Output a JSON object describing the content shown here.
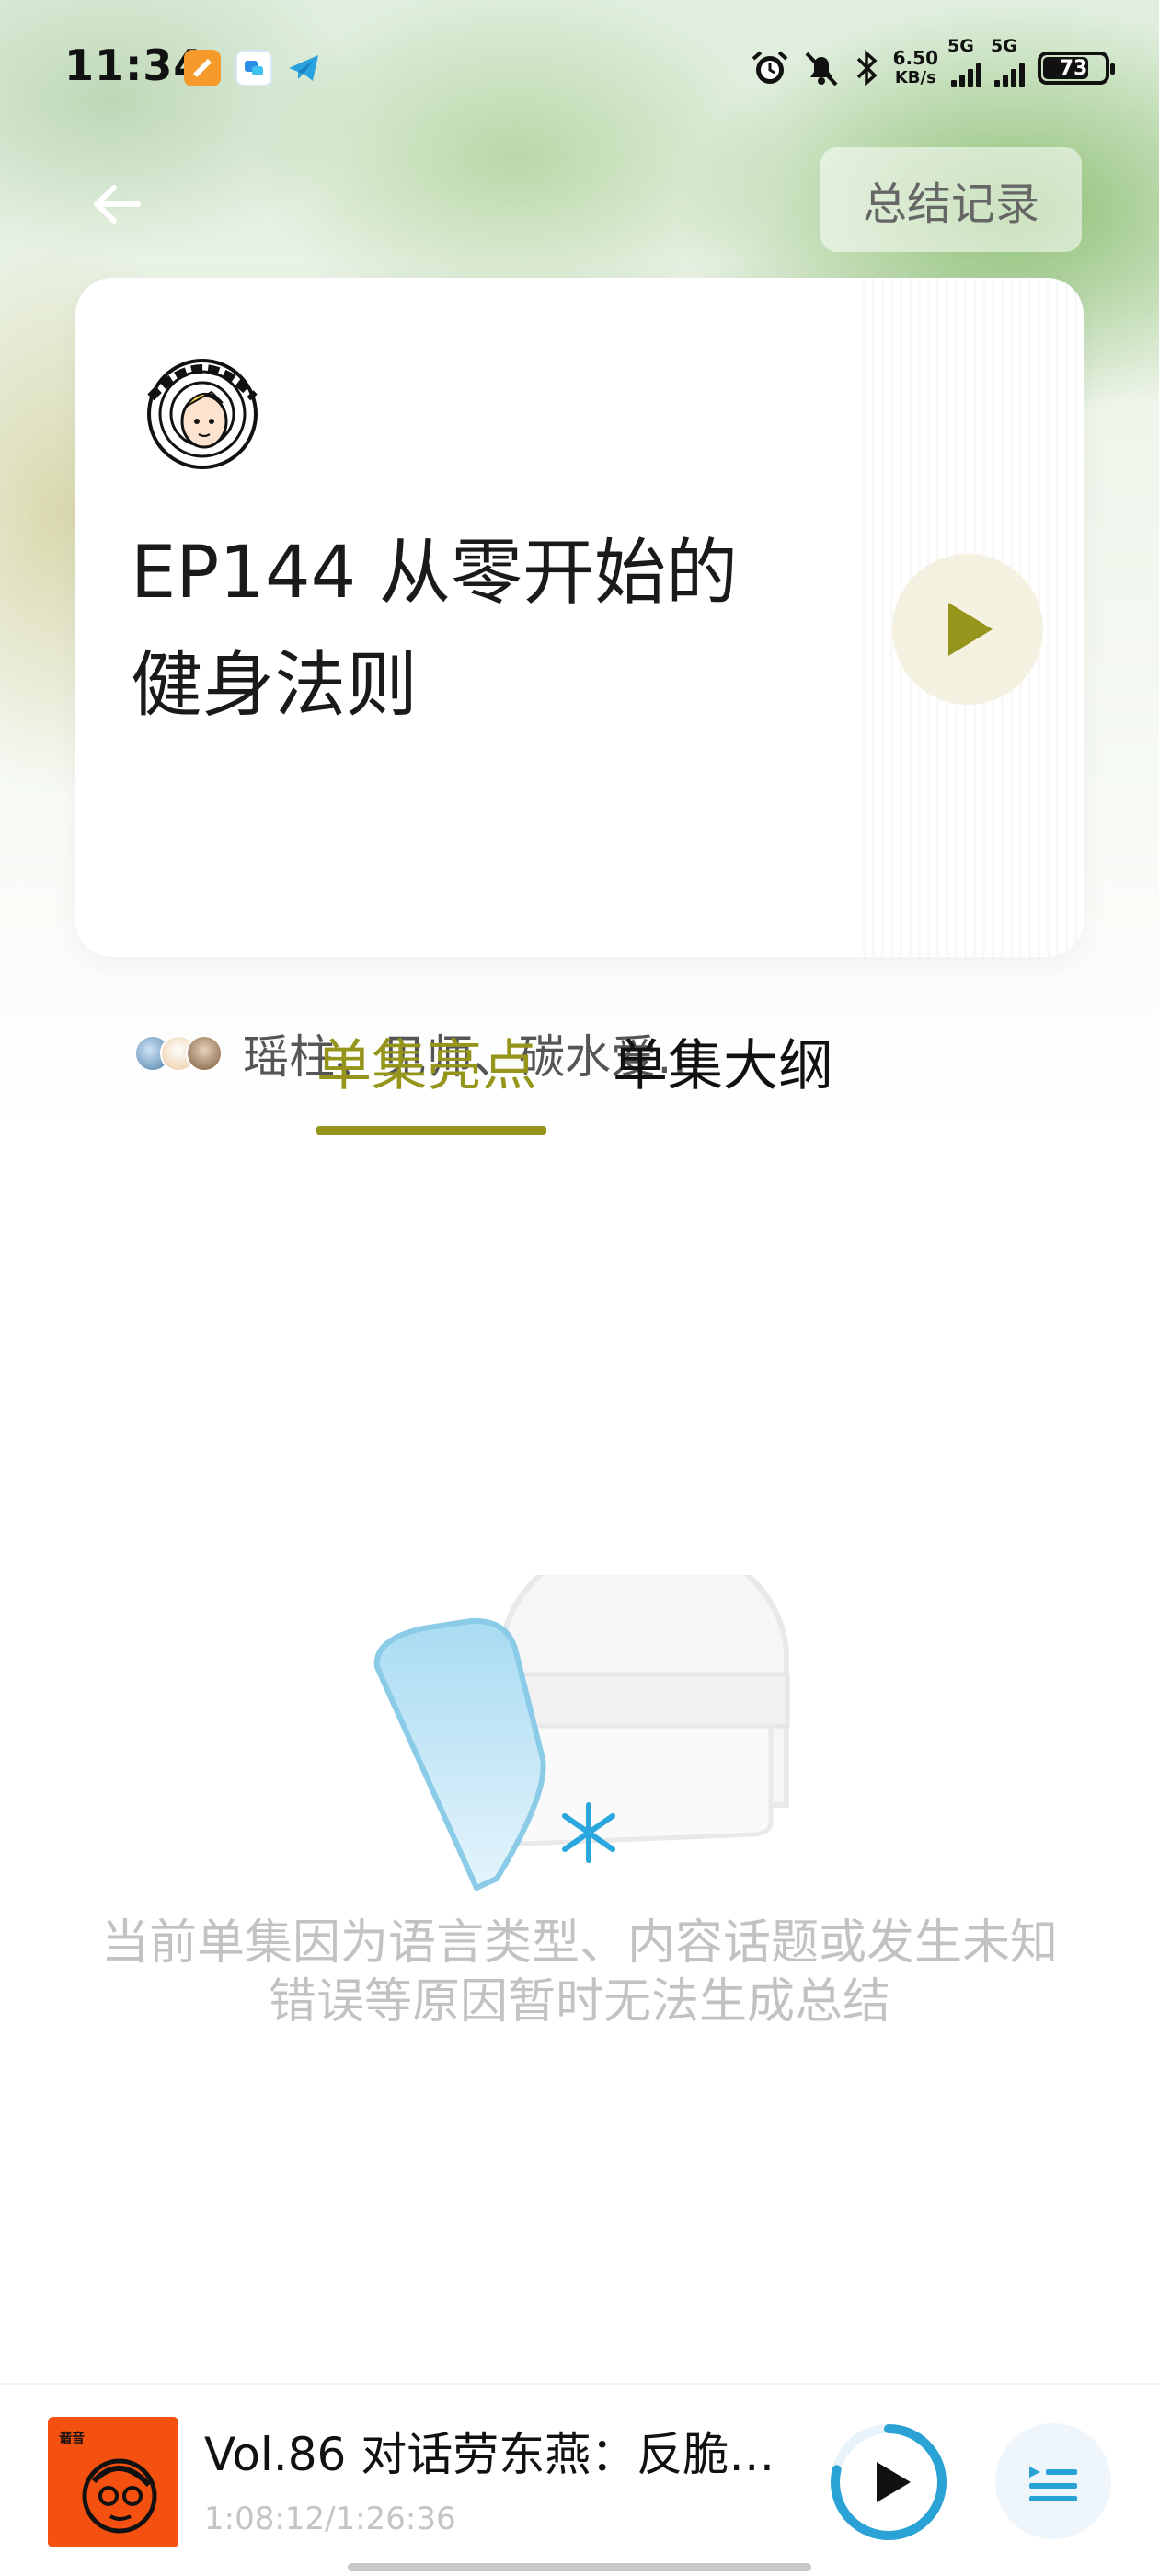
{
  "status_bar": {
    "time": "11:34",
    "net_speed": "6.50",
    "net_unit": "KB/s",
    "sim1": "5G",
    "sim2": "5G",
    "battery": "73"
  },
  "header": {
    "summary_button": "总结记录"
  },
  "episode": {
    "title_line1": "EP144 从零开始的",
    "title_line2": "健身法则",
    "hosts": "瑶柱、见师、碳水爱…",
    "accent_color": "#96951b"
  },
  "tabs": [
    {
      "label": "单集亮点",
      "active": true
    },
    {
      "label": "单集大纲",
      "active": false
    }
  ],
  "empty_state": {
    "line1": "当前单集因为语言类型、内容话题或发生未知",
    "line2": "错误等原因暂时无法生成总结"
  },
  "now_playing": {
    "title": "Vol.86 对话劳东燕：反脆…",
    "time": "1:08:12/1:26:36",
    "progress": 0.787,
    "ring_color": "#2aa2d6"
  }
}
